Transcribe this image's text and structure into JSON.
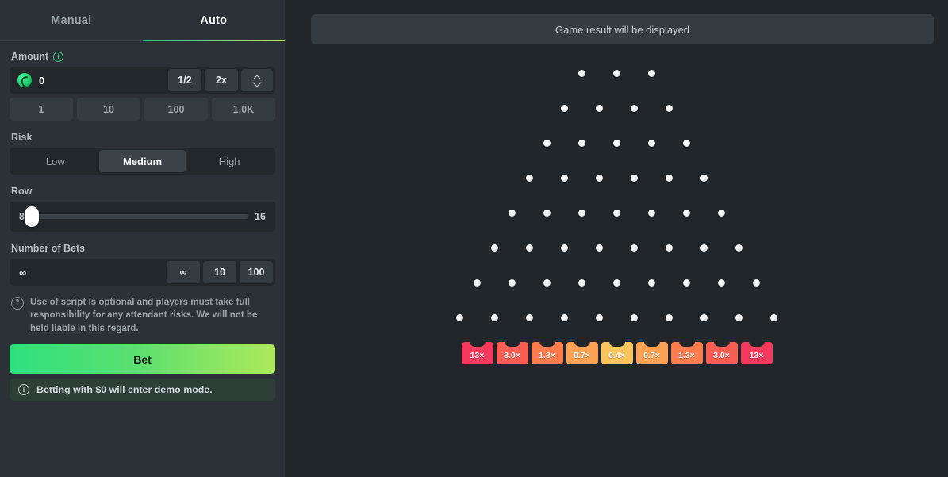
{
  "sidebar": {
    "tabs": [
      {
        "label": "Manual",
        "active": false
      },
      {
        "label": "Auto",
        "active": true
      }
    ],
    "amount": {
      "label": "Amount",
      "value": "0",
      "coin_icon": "coin-icon",
      "info_icon": "info-icon",
      "half_label": "1/2",
      "double_label": "2x",
      "stepper_up_icon": "chevron-up-icon",
      "stepper_down_icon": "chevron-down-icon",
      "quick_values": [
        "1",
        "10",
        "100",
        "1.0K"
      ]
    },
    "risk": {
      "label": "Risk",
      "options": [
        "Low",
        "Medium",
        "High"
      ],
      "selected": "Medium"
    },
    "row": {
      "label": "Row",
      "min": "8",
      "max": "16",
      "value": 8,
      "percent": 0
    },
    "number_of_bets": {
      "label": "Number of Bets",
      "value": "∞",
      "placeholder": "∞",
      "quick_values": [
        "∞",
        "10",
        "100"
      ]
    },
    "disclaimer": {
      "icon": "question-icon",
      "text": "Use of script is optional and players must take full responsibility for any attendant risks. We will not be held liable in this regard."
    },
    "bet_button": {
      "label": "Bet"
    },
    "demo_note": {
      "icon": "info-icon",
      "text": "Betting with $0 will enter demo mode."
    }
  },
  "main": {
    "result_bar": {
      "text": "Game result will be displayed"
    },
    "board": {
      "rows": 8,
      "peg_counts": [
        3,
        4,
        5,
        6,
        7,
        8,
        9,
        10
      ],
      "multipliers": [
        {
          "label": "13×",
          "color": "#f43a5c"
        },
        {
          "label": "3.0×",
          "color": "#fa5e52"
        },
        {
          "label": "1.3×",
          "color": "#fc7c4d"
        },
        {
          "label": "0.7×",
          "color": "#fda155"
        },
        {
          "label": "0.4×",
          "color": "#fbc45e"
        },
        {
          "label": "0.7×",
          "color": "#fda155"
        },
        {
          "label": "1.3×",
          "color": "#fc7c4d"
        },
        {
          "label": "3.0×",
          "color": "#fa5e52"
        },
        {
          "label": "13×",
          "color": "#f43a5c"
        }
      ]
    }
  },
  "theme": {
    "bg": "#20262a",
    "sidebar_bg": "#2b3136",
    "input_bg": "#22272b",
    "btn_bg": "#343b41",
    "accent_green": "#2ee080",
    "accent_lime": "#aee85b",
    "text_primary": "#f2f5f6",
    "text_muted": "#9aa3a8"
  }
}
